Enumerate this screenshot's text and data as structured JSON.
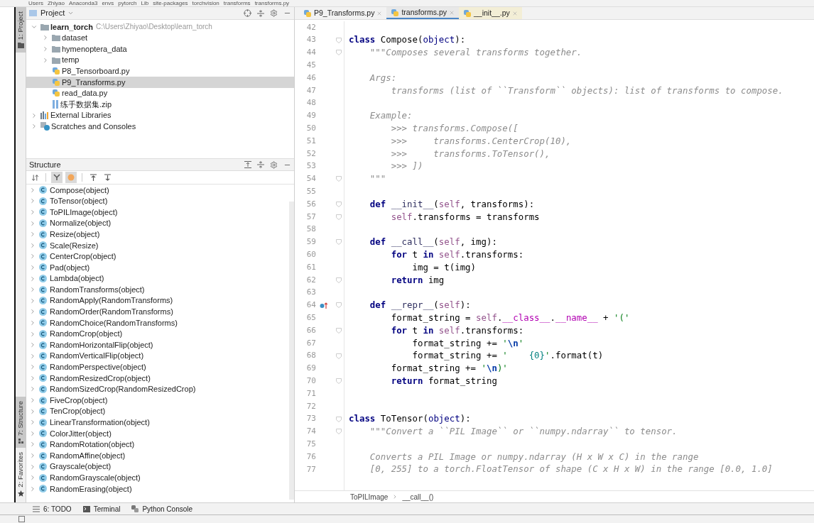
{
  "breadcrumb": [
    "Users",
    "Zhiyao",
    "Anaconda3",
    "envs",
    "pytorch",
    "Lib",
    "site-packages",
    "torchvision",
    "transforms",
    "transforms.py"
  ],
  "tool_strip": [
    {
      "label": "1: Project",
      "selected": true
    },
    {
      "label": "7: Structure",
      "selected": true
    },
    {
      "label": "2: Favorites",
      "selected": false
    }
  ],
  "project": {
    "title": "Project",
    "tree": [
      {
        "kind": "root",
        "name": "learn_torch",
        "path": "C:\\Users\\Zhiyao\\Desktop\\learn_torch",
        "expanded": true,
        "selected": false,
        "children": [
          {
            "kind": "folder",
            "name": "dataset",
            "expanded": false,
            "selected": false
          },
          {
            "kind": "folder",
            "name": "hymenoptera_data",
            "expanded": false,
            "selected": false
          },
          {
            "kind": "folder",
            "name": "temp",
            "expanded": false,
            "selected": false
          },
          {
            "kind": "python",
            "name": "P8_Tensorboard.py",
            "selected": false
          },
          {
            "kind": "python",
            "name": "P9_Transforms.py",
            "selected": true
          },
          {
            "kind": "python",
            "name": "read_data.py",
            "selected": false
          },
          {
            "kind": "archive",
            "name": "练手数据集.zip",
            "selected": false
          }
        ]
      },
      {
        "kind": "library",
        "name": "External Libraries",
        "expanded": false,
        "selected": false
      },
      {
        "kind": "scratches",
        "name": "Scratches and Consoles",
        "expanded": false,
        "selected": false
      }
    ]
  },
  "structure": {
    "title": "Structure",
    "toolbar": [
      {
        "kind": "sort",
        "on": false
      },
      {
        "kind": "inherited",
        "on": true
      },
      {
        "kind": "fields",
        "on": true
      },
      {
        "kind": "expand",
        "on": false
      },
      {
        "kind": "collapse",
        "on": false
      }
    ],
    "items": [
      {
        "name": "Compose(object)",
        "expanded": false
      },
      {
        "name": "ToTensor(object)",
        "expanded": false
      },
      {
        "name": "ToPILImage(object)",
        "expanded": false
      },
      {
        "name": "Normalize(object)",
        "expanded": false
      },
      {
        "name": "Resize(object)",
        "expanded": false
      },
      {
        "name": "Scale(Resize)",
        "expanded": false
      },
      {
        "name": "CenterCrop(object)",
        "expanded": false
      },
      {
        "name": "Pad(object)",
        "expanded": false
      },
      {
        "name": "Lambda(object)",
        "expanded": false
      },
      {
        "name": "RandomTransforms(object)",
        "expanded": false
      },
      {
        "name": "RandomApply(RandomTransforms)",
        "expanded": false
      },
      {
        "name": "RandomOrder(RandomTransforms)",
        "expanded": false
      },
      {
        "name": "RandomChoice(RandomTransforms)",
        "expanded": false
      },
      {
        "name": "RandomCrop(object)",
        "expanded": false
      },
      {
        "name": "RandomHorizontalFlip(object)",
        "expanded": false
      },
      {
        "name": "RandomVerticalFlip(object)",
        "expanded": false
      },
      {
        "name": "RandomPerspective(object)",
        "expanded": false
      },
      {
        "name": "RandomResizedCrop(object)",
        "expanded": false
      },
      {
        "name": "RandomSizedCrop(RandomResizedCrop)",
        "expanded": false
      },
      {
        "name": "FiveCrop(object)",
        "expanded": false
      },
      {
        "name": "TenCrop(object)",
        "expanded": false
      },
      {
        "name": "LinearTransformation(object)",
        "expanded": false
      },
      {
        "name": "ColorJitter(object)",
        "expanded": false
      },
      {
        "name": "RandomRotation(object)",
        "expanded": false
      },
      {
        "name": "RandomAffine(object)",
        "expanded": false
      },
      {
        "name": "Grayscale(object)",
        "expanded": false
      },
      {
        "name": "RandomGrayscale(object)",
        "expanded": false
      },
      {
        "name": "RandomErasing(object)",
        "expanded": false
      }
    ]
  },
  "editor": {
    "tabs": [
      {
        "label": "P9_Transforms.py",
        "selected": false,
        "external": false
      },
      {
        "label": "transforms.py",
        "selected": true,
        "external": false
      },
      {
        "label": "__init__.py",
        "selected": false,
        "external": true
      }
    ],
    "lines": [
      {
        "number": "42"
      },
      {
        "number": "43",
        "fold": true,
        "tokens": [
          {
            "kind": "kw",
            "text": "class"
          },
          {
            "kind": "plain",
            "text": " Compose("
          },
          {
            "kind": "builtin",
            "text": "object"
          },
          {
            "kind": "plain",
            "text": "):"
          }
        ]
      },
      {
        "number": "44",
        "fold": true,
        "tokens": [
          {
            "kind": "doc",
            "text": "    \"\"\"Composes several transforms together."
          }
        ]
      },
      {
        "number": "45"
      },
      {
        "number": "46",
        "tokens": [
          {
            "kind": "doc",
            "text": "    Args:"
          }
        ]
      },
      {
        "number": "47",
        "tokens": [
          {
            "kind": "doc",
            "text": "        transforms (list of ``Transform`` objects): list of transforms to compose."
          }
        ]
      },
      {
        "number": "48"
      },
      {
        "number": "49",
        "tokens": [
          {
            "kind": "doc",
            "text": "    Example:"
          }
        ]
      },
      {
        "number": "50",
        "tokens": [
          {
            "kind": "doc",
            "text": "        >>> transforms.Compose(["
          }
        ]
      },
      {
        "number": "51",
        "tokens": [
          {
            "kind": "doc",
            "text": "        >>>     transforms.CenterCrop(10),"
          }
        ]
      },
      {
        "number": "52",
        "tokens": [
          {
            "kind": "doc",
            "text": "        >>>     transforms.ToTensor(),"
          }
        ]
      },
      {
        "number": "53",
        "tokens": [
          {
            "kind": "doc",
            "text": "        >>> ])"
          }
        ]
      },
      {
        "number": "54",
        "fold": true,
        "tokens": [
          {
            "kind": "doc",
            "text": "    \"\"\""
          }
        ]
      },
      {
        "number": "55"
      },
      {
        "number": "56",
        "fold": true,
        "tokens": [
          {
            "kind": "kw",
            "text": "    def"
          },
          {
            "kind": "fn",
            "text": " __init__"
          },
          {
            "kind": "plain",
            "text": "("
          },
          {
            "kind": "self",
            "text": "self"
          },
          {
            "kind": "plain",
            "text": ", transforms):"
          }
        ]
      },
      {
        "number": "57",
        "fold": true,
        "tokens": [
          {
            "kind": "self",
            "text": "        self"
          },
          {
            "kind": "plain",
            "text": ".transforms = transforms"
          }
        ]
      },
      {
        "number": "58"
      },
      {
        "number": "59",
        "fold": true,
        "tokens": [
          {
            "kind": "kw",
            "text": "    def"
          },
          {
            "kind": "fn",
            "text": " __call__"
          },
          {
            "kind": "plain",
            "text": "("
          },
          {
            "kind": "self",
            "text": "self"
          },
          {
            "kind": "plain",
            "text": ", img):"
          }
        ]
      },
      {
        "number": "60",
        "tokens": [
          {
            "kind": "kw",
            "text": "        for"
          },
          {
            "kind": "plain",
            "text": " t "
          },
          {
            "kind": "kw",
            "text": "in"
          },
          {
            "kind": "self",
            "text": " self"
          },
          {
            "kind": "plain",
            "text": ".transforms:"
          }
        ]
      },
      {
        "number": "61",
        "tokens": [
          {
            "kind": "plain",
            "text": "            img = t(img)"
          }
        ]
      },
      {
        "number": "62",
        "fold": true,
        "tokens": [
          {
            "kind": "kw",
            "text": "        return"
          },
          {
            "kind": "plain",
            "text": " img"
          }
        ]
      },
      {
        "number": "63"
      },
      {
        "number": "64",
        "fold": true,
        "override": true,
        "tokens": [
          {
            "kind": "kw",
            "text": "    def"
          },
          {
            "kind": "fn",
            "text": " __repr__"
          },
          {
            "kind": "plain",
            "text": "("
          },
          {
            "kind": "self",
            "text": "self"
          },
          {
            "kind": "plain",
            "text": "):"
          }
        ]
      },
      {
        "number": "65",
        "tokens": [
          {
            "kind": "plain",
            "text": "        format_string = "
          },
          {
            "kind": "self",
            "text": "self"
          },
          {
            "kind": "plain",
            "text": "."
          },
          {
            "kind": "magic",
            "text": "__class__"
          },
          {
            "kind": "plain",
            "text": "."
          },
          {
            "kind": "magic",
            "text": "__name__"
          },
          {
            "kind": "plain",
            "text": " + "
          },
          {
            "kind": "str",
            "text": "'('"
          }
        ]
      },
      {
        "number": "66",
        "fold": true,
        "tokens": [
          {
            "kind": "kw",
            "text": "        for"
          },
          {
            "kind": "plain",
            "text": " t "
          },
          {
            "kind": "kw",
            "text": "in"
          },
          {
            "kind": "self",
            "text": " self"
          },
          {
            "kind": "plain",
            "text": ".transforms:"
          }
        ]
      },
      {
        "number": "67",
        "tokens": [
          {
            "kind": "plain",
            "text": "            format_string += "
          },
          {
            "kind": "str",
            "text": "'"
          },
          {
            "kind": "escape",
            "text": "\\n"
          },
          {
            "kind": "str",
            "text": "'"
          }
        ]
      },
      {
        "number": "68",
        "fold": true,
        "tokens": [
          {
            "kind": "plain",
            "text": "            format_string += "
          },
          {
            "kind": "str",
            "text": "'    "
          },
          {
            "kind": "format",
            "text": "{0}"
          },
          {
            "kind": "str",
            "text": "'"
          },
          {
            "kind": "plain",
            "text": ".format(t)"
          }
        ]
      },
      {
        "number": "69",
        "tokens": [
          {
            "kind": "plain",
            "text": "        format_string += "
          },
          {
            "kind": "str",
            "text": "'"
          },
          {
            "kind": "escape",
            "text": "\\n"
          },
          {
            "kind": "str",
            "text": ")'"
          }
        ]
      },
      {
        "number": "70",
        "fold": true,
        "tokens": [
          {
            "kind": "kw",
            "text": "        return"
          },
          {
            "kind": "plain",
            "text": " format_string"
          }
        ]
      },
      {
        "number": "71"
      },
      {
        "number": "72"
      },
      {
        "number": "73",
        "fold": true,
        "tokens": [
          {
            "kind": "kw",
            "text": "class"
          },
          {
            "kind": "plain",
            "text": " ToTensor("
          },
          {
            "kind": "builtin",
            "text": "object"
          },
          {
            "kind": "plain",
            "text": "):"
          }
        ]
      },
      {
        "number": "74",
        "fold": true,
        "tokens": [
          {
            "kind": "doc",
            "text": "    \"\"\"Convert a ``PIL Image`` or ``numpy.ndarray`` to tensor."
          }
        ]
      },
      {
        "number": "75"
      },
      {
        "number": "76",
        "tokens": [
          {
            "kind": "doc",
            "text": "    Converts a PIL Image or numpy.ndarray (H x W x C) in the range"
          }
        ]
      },
      {
        "number": "77",
        "tokens": [
          {
            "kind": "doc",
            "text": "    [0, 255] to a torch.FloatTensor of shape (C x H x W) in the range [0.0, 1.0]"
          }
        ]
      }
    ],
    "breadcrumb": [
      "ToPILImage",
      "__call__()"
    ]
  },
  "bottom_tools": [
    {
      "kind": "todo",
      "label": "6: TODO"
    },
    {
      "kind": "terminal",
      "label": "Terminal"
    },
    {
      "kind": "console",
      "label": "Python Console"
    }
  ]
}
